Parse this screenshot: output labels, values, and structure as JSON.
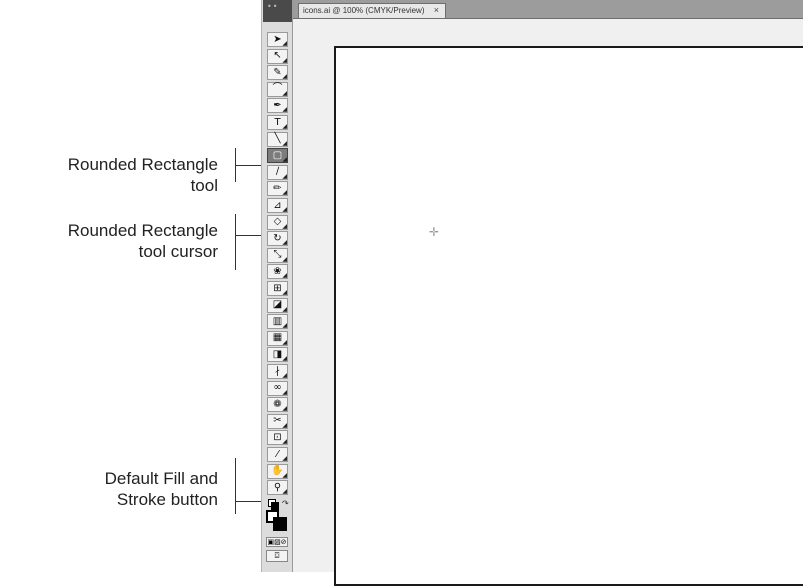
{
  "callouts": {
    "rounded_rect_tool": "Rounded Rectangle tool",
    "cursor_line1": "Rounded Rectangle",
    "cursor_line2": "tool cursor",
    "default_fill_line1": "Default Fill and",
    "default_fill_line2": "Stroke button"
  },
  "document": {
    "tab_title": "icons.ai @ 100% (CMYK/Preview)",
    "tab_close": "×",
    "grip": "••"
  },
  "tools": [
    {
      "name": "selection-tool-icon",
      "glyph": "➤"
    },
    {
      "name": "direct-selection-tool-icon",
      "glyph": "↖"
    },
    {
      "name": "magic-wand-tool-icon",
      "glyph": "✎"
    },
    {
      "name": "lasso-tool-icon",
      "glyph": "⌒"
    },
    {
      "name": "pen-tool-icon",
      "glyph": "✒"
    },
    {
      "name": "type-tool-icon",
      "glyph": "T"
    },
    {
      "name": "line-segment-tool-icon",
      "glyph": "╲"
    },
    {
      "name": "rounded-rectangle-tool-icon",
      "glyph": "▢"
    },
    {
      "name": "paintbrush-tool-icon",
      "glyph": "∕"
    },
    {
      "name": "pencil-tool-icon",
      "glyph": "✏"
    },
    {
      "name": "blob-brush-tool-icon",
      "glyph": "⊿"
    },
    {
      "name": "eraser-tool-icon",
      "glyph": "◇"
    },
    {
      "name": "rotate-tool-icon",
      "glyph": "↻"
    },
    {
      "name": "scale-tool-icon",
      "glyph": "⤡"
    },
    {
      "name": "warp-tool-icon",
      "glyph": "❀"
    },
    {
      "name": "free-transform-tool-icon",
      "glyph": "⊞"
    },
    {
      "name": "shape-builder-tool-icon",
      "glyph": "◪"
    },
    {
      "name": "graph-tool-icon",
      "glyph": "▥"
    },
    {
      "name": "mesh-tool-icon",
      "glyph": "▦"
    },
    {
      "name": "gradient-tool-icon",
      "glyph": "◨"
    },
    {
      "name": "eyedropper-tool-icon",
      "glyph": "∤"
    },
    {
      "name": "blend-tool-icon",
      "glyph": "∞"
    },
    {
      "name": "symbol-sprayer-tool-icon",
      "glyph": "❁"
    },
    {
      "name": "column-graph-tool-icon",
      "glyph": "✂"
    },
    {
      "name": "artboard-tool-icon",
      "glyph": "⊡"
    },
    {
      "name": "slice-tool-icon",
      "glyph": "⁄"
    },
    {
      "name": "hand-tool-icon",
      "glyph": "✋"
    },
    {
      "name": "zoom-tool-icon",
      "glyph": "⚲"
    }
  ],
  "colors": {
    "toolbar_bg": "#dcdcdc",
    "active_tool": "#7c7c7c",
    "artboard_border": "#1a1a1a",
    "tab_bar": "#9c9c9c"
  }
}
